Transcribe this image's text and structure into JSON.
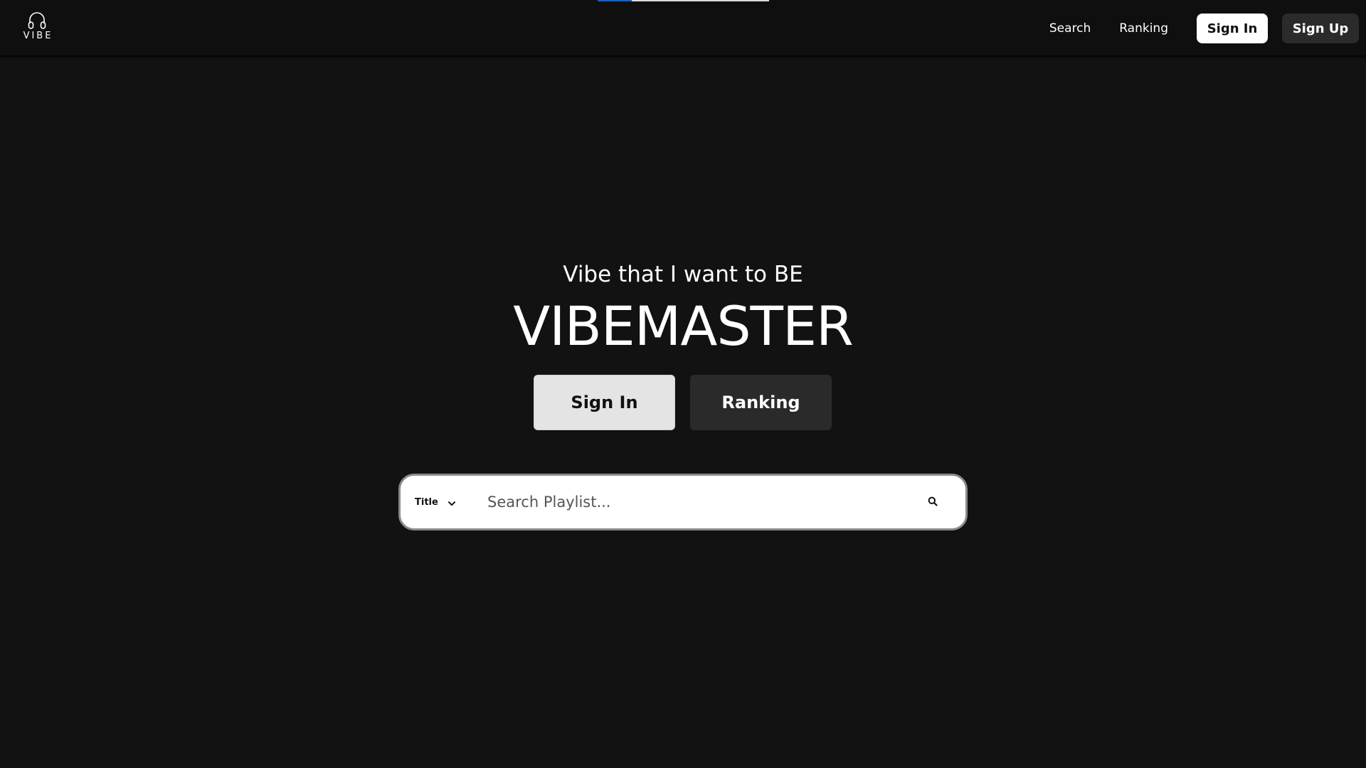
{
  "header": {
    "logo_text": "VIBE",
    "nav": {
      "search": "Search",
      "ranking": "Ranking",
      "sign_in": "Sign In",
      "sign_up": "Sign Up"
    }
  },
  "hero": {
    "tagline": "Vibe that I want to BE",
    "title": "VIBEMASTER",
    "sign_in_button": "Sign In",
    "ranking_button": "Ranking"
  },
  "search": {
    "filter_selected": "Title",
    "placeholder": "Search Playlist...",
    "value": ""
  },
  "icons": {
    "logo": "headphones-icon",
    "filter": "chevron-down-icon",
    "search": "search-icon"
  },
  "colors": {
    "background": "#121212",
    "header_background": "#0f0f0f",
    "primary_button": "#ffffff",
    "secondary_button": "#2b2b2b",
    "loading_bar_fill": "#1f5fbf"
  }
}
